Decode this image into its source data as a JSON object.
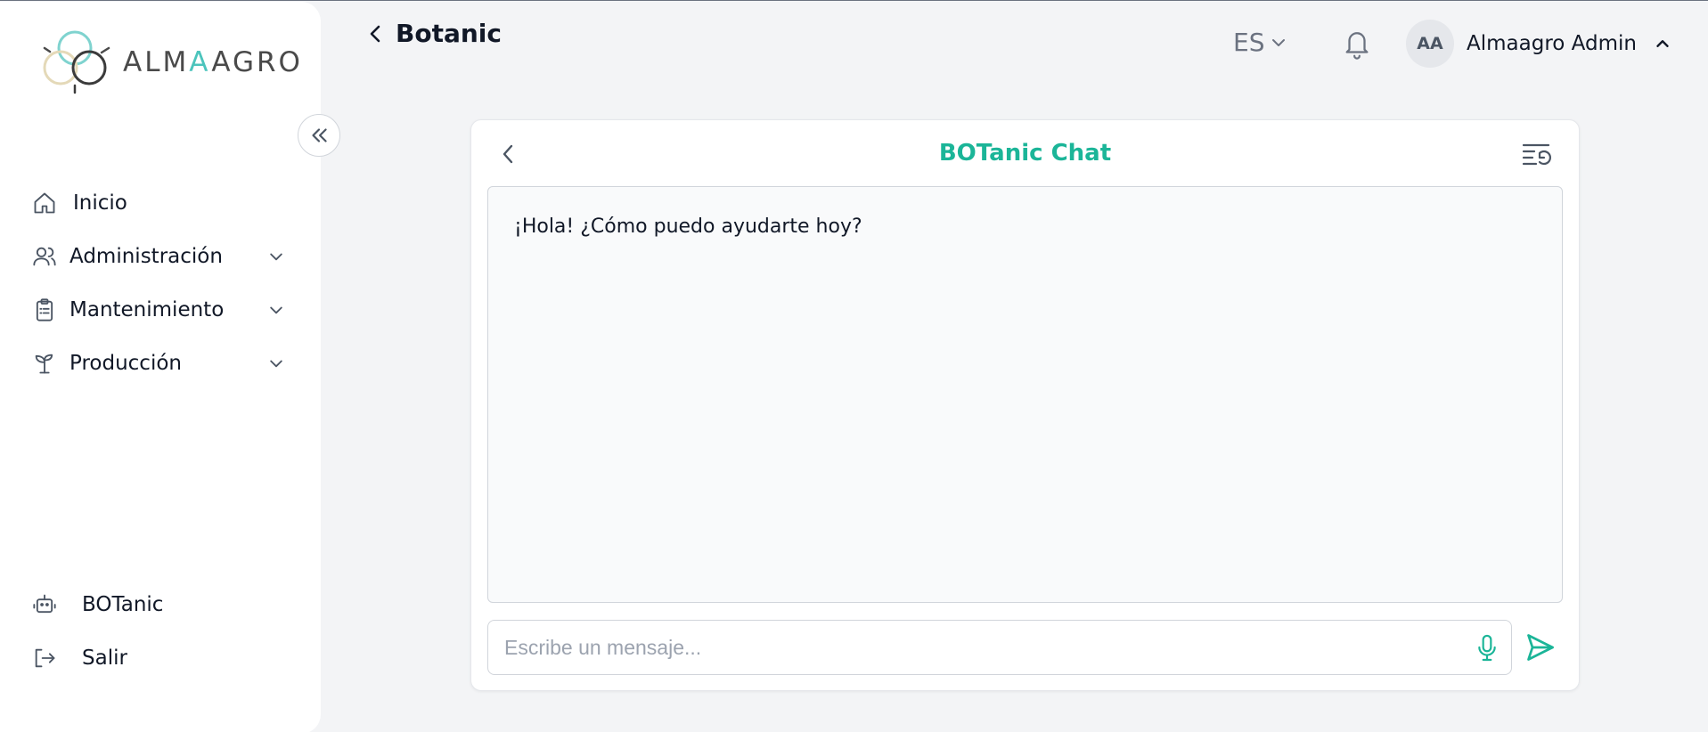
{
  "brand": {
    "logo_text_a": "ALM",
    "logo_text_b": "A",
    "logo_text_c": "AGRO"
  },
  "sidebar": {
    "items": [
      {
        "label": "Inicio",
        "icon": "home-icon"
      },
      {
        "label": "Administración",
        "icon": "users-icon"
      },
      {
        "label": "Mantenimiento",
        "icon": "clipboard-icon"
      },
      {
        "label": "Producción",
        "icon": "sprout-icon"
      }
    ],
    "bottom": [
      {
        "label": "BOTanic",
        "icon": "robot-icon"
      },
      {
        "label": "Salir",
        "icon": "logout-icon"
      }
    ]
  },
  "header": {
    "title": "Botanic",
    "language": "ES",
    "user": {
      "initials": "AA",
      "name": "Almaagro Admin"
    }
  },
  "chat": {
    "title": "BOTanic Chat",
    "messages": [
      {
        "text": "¡Hola! ¿Cómo puedo ayudarte hoy?"
      }
    ],
    "input_placeholder": "Escribe un mensaje..."
  },
  "colors": {
    "accent": "#1bb598",
    "logo_teal": "#4cc4bc"
  }
}
